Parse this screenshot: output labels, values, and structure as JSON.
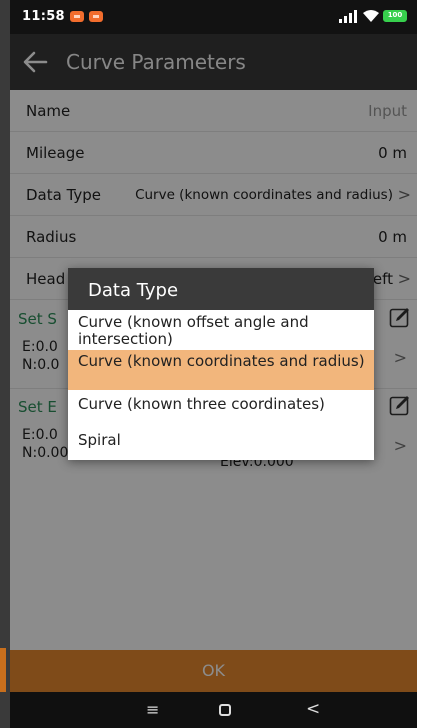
{
  "status": {
    "time": "11:58",
    "battery": "100"
  },
  "header": {
    "title": "Curve Parameters"
  },
  "fields": {
    "name": {
      "label": "Name",
      "value": "Input"
    },
    "mileage": {
      "label": "Mileage",
      "value": "0 m"
    },
    "data_type": {
      "label": "Data Type",
      "value": "Curve (known coordinates and radius)"
    },
    "radius": {
      "label": "Radius",
      "value": "0 m"
    },
    "heading": {
      "label": "Head",
      "value": "Left"
    }
  },
  "sections": {
    "start": {
      "title": "Set S",
      "e": "E:0.0",
      "n": "N:0.0"
    },
    "end": {
      "title": "Set E",
      "e": "E:0.0",
      "n": "N:0.000",
      "elev": "Elev:0.000"
    }
  },
  "dialog": {
    "title": "Data Type",
    "options": [
      "Curve (known offset angle and intersection)",
      "Curve (known coordinates and radius)",
      "Curve (known three coordinates)",
      "Spiral"
    ],
    "selected_index": 1
  },
  "footer": {
    "ok_label": "OK"
  },
  "navbar": {
    "menu": "≡",
    "back": "<"
  },
  "colors": {
    "accent": "#e8892f",
    "section": "#2c8f59",
    "selected": "#f2b67c",
    "appbar": "#3a3a3a"
  },
  "icons": [
    "back-arrow-icon",
    "edit-icon",
    "chevron-right-icon",
    "signal-icon",
    "wifi-icon",
    "battery-icon"
  ]
}
